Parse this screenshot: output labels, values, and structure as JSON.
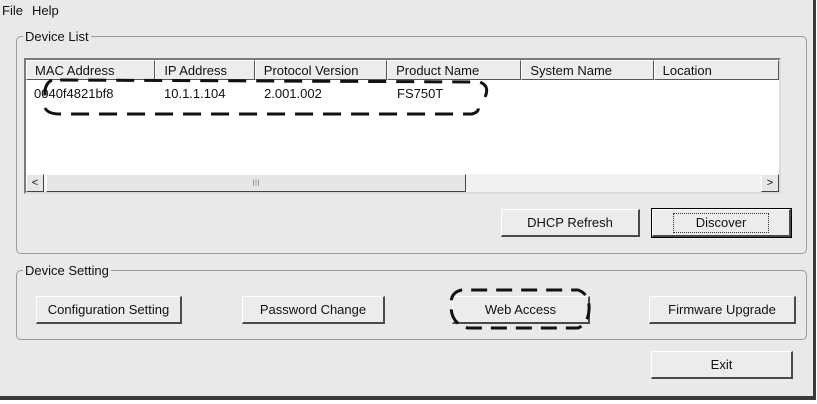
{
  "menu": {
    "file": "File",
    "help": "Help"
  },
  "device_list": {
    "legend": "Device List",
    "columns": [
      "MAC Address",
      "IP Address",
      "Protocol Version",
      "Product Name",
      "System Name",
      "Location"
    ],
    "rows": [
      {
        "mac": "0040f4821bf8",
        "ip": "10.1.1.104",
        "protocol": "2.001.002",
        "product": "FS750T",
        "system": "",
        "location": ""
      }
    ],
    "scroll_left": "<",
    "scroll_right": ">",
    "thumb_grip": "III",
    "dhcp_refresh": "DHCP Refresh",
    "discover": "Discover"
  },
  "device_setting": {
    "legend": "Device Setting",
    "configuration": "Configuration Setting",
    "password": "Password Change",
    "web_access": "Web Access",
    "firmware": "Firmware Upgrade"
  },
  "exit": "Exit"
}
